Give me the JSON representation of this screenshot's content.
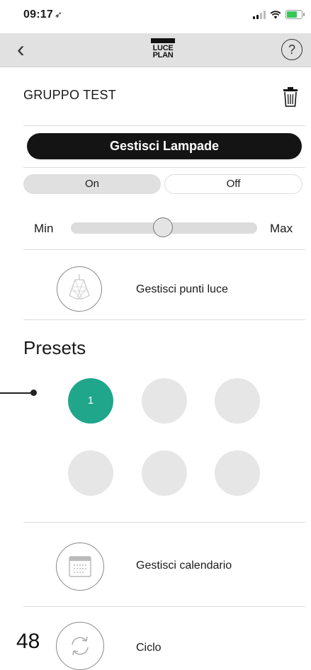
{
  "status_bar": {
    "time": "09:17",
    "location_glyph": "➶"
  },
  "nav": {
    "back_glyph": "‹",
    "logo_line1": "LUCE",
    "logo_line2": "PLAN",
    "help_glyph": "?"
  },
  "group": {
    "title": "GRUPPO TEST"
  },
  "manage_lamps": {
    "label": "Gestisci Lampade"
  },
  "power": {
    "on_label": "On",
    "off_label": "Off",
    "selected": "On"
  },
  "dimmer": {
    "min_label": "Min",
    "max_label": "Max",
    "level": 0.5
  },
  "light_points": {
    "label": "Gestisci punti luce"
  },
  "presets": {
    "title": "Presets",
    "items": [
      {
        "label": "1",
        "active": true
      },
      {
        "label": "",
        "active": false
      },
      {
        "label": "",
        "active": false
      },
      {
        "label": "",
        "active": false
      },
      {
        "label": "",
        "active": false
      },
      {
        "label": "",
        "active": false
      }
    ]
  },
  "calendar": {
    "label": "Gestisci calendario"
  },
  "cycle": {
    "label": "Ciclo"
  },
  "annotation": {
    "page_number": "48"
  },
  "colors": {
    "accent": "#1fa68b",
    "dark_button": "#141414",
    "navbar": "#e1e1e1"
  }
}
